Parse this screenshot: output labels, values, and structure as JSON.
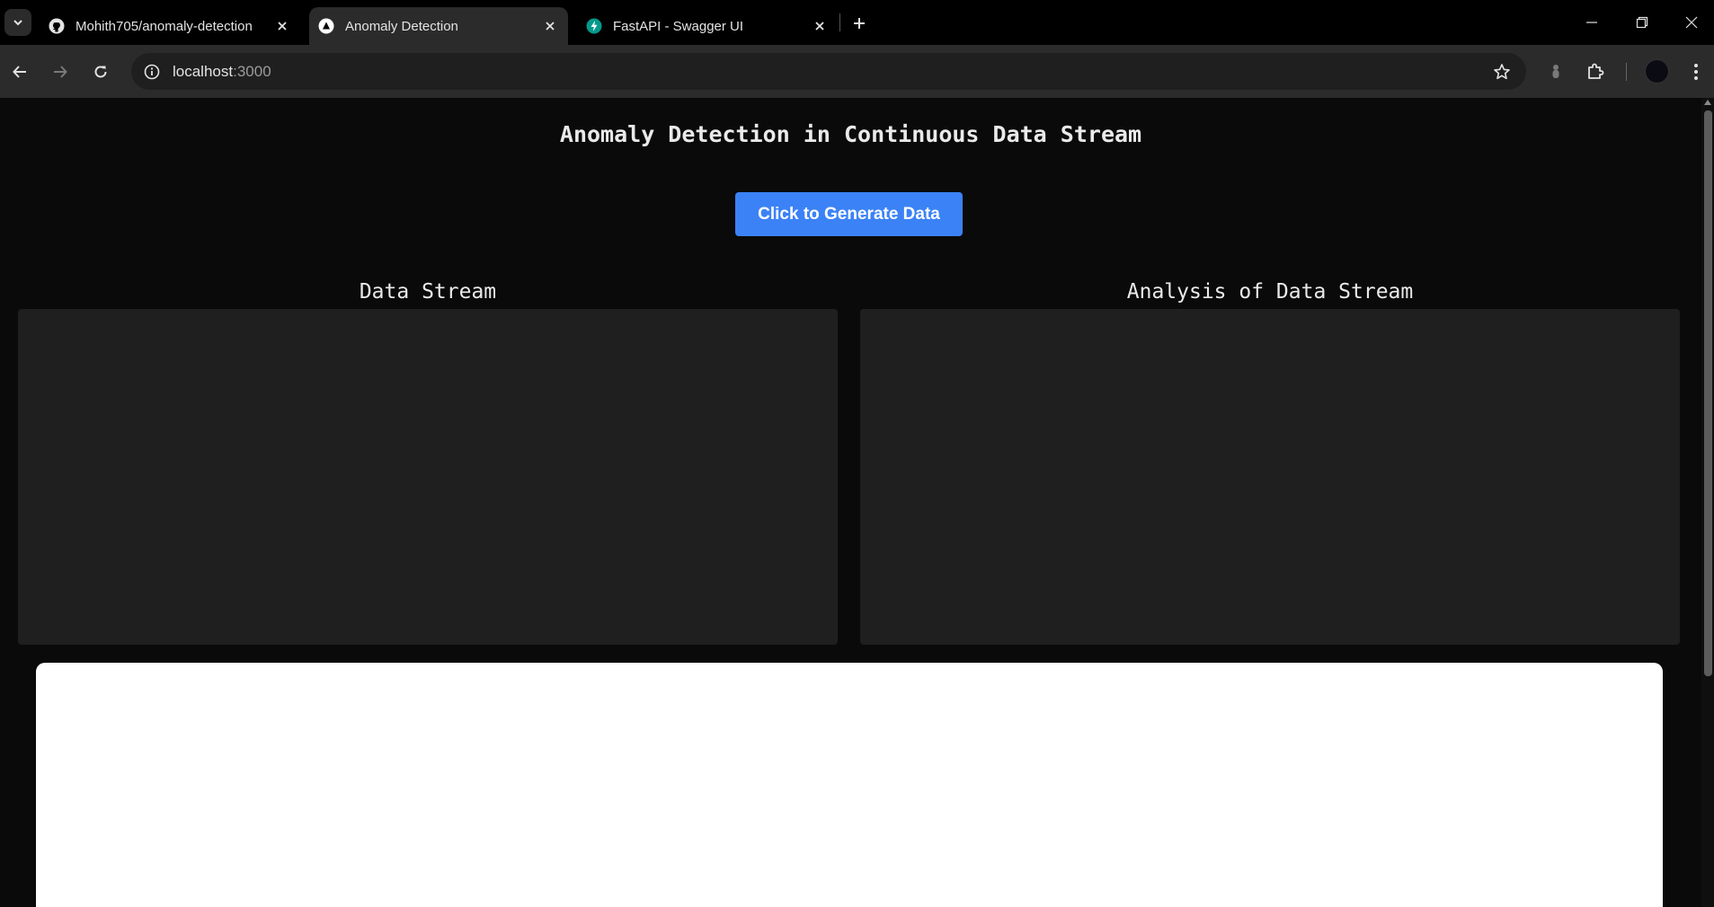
{
  "browser": {
    "tabs": [
      {
        "title": "Mohith705/anomaly-detection",
        "favicon": "github-icon",
        "active": false
      },
      {
        "title": "Anomaly Detection",
        "favicon": "triangle-icon",
        "active": true
      },
      {
        "title": "FastAPI - Swagger UI",
        "favicon": "fastapi-icon",
        "active": false
      }
    ],
    "address": {
      "host": "localhost",
      "port": ":3000"
    }
  },
  "page": {
    "title": "Anomaly Detection in Continuous Data Stream",
    "generate_button": "Click to Generate Data",
    "panels": {
      "left_title": "Data Stream",
      "right_title": "Analysis of Data Stream"
    }
  },
  "colors": {
    "accent": "#3b82f6",
    "page_bg": "#0a0a0a",
    "panel_bg": "#1f1f1f"
  }
}
